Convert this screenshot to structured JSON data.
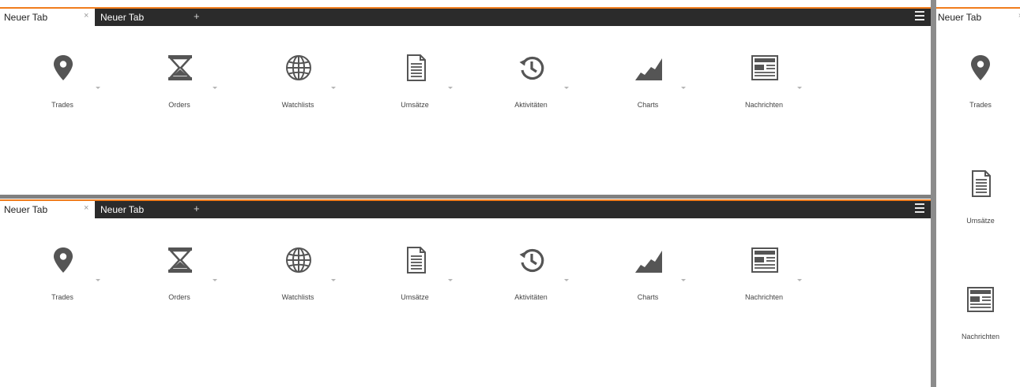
{
  "colors": {
    "accent": "#f07c1c",
    "tabbar_bg": "#2b2b2b",
    "icon": "#555555",
    "splitter": "#8c8c8c"
  },
  "panel_top": {
    "tabs": [
      {
        "label": "Neuer Tab",
        "close": "×"
      },
      {
        "label": "Neuer Tab"
      }
    ],
    "add_label": "+",
    "tiles": [
      {
        "label": "Trades",
        "icon": "map-marker-icon"
      },
      {
        "label": "Orders",
        "icon": "hourglass-icon"
      },
      {
        "label": "Watchlists",
        "icon": "globe-icon"
      },
      {
        "label": "Umsätze",
        "icon": "document-icon"
      },
      {
        "label": "Aktivitäten",
        "icon": "history-icon"
      },
      {
        "label": "Charts",
        "icon": "area-chart-icon"
      },
      {
        "label": "Nachrichten",
        "icon": "newspaper-icon"
      }
    ]
  },
  "panel_bottom": {
    "tabs": [
      {
        "label": "Neuer Tab",
        "close": "×"
      },
      {
        "label": "Neuer Tab"
      }
    ],
    "add_label": "+",
    "tiles": [
      {
        "label": "Trades",
        "icon": "map-marker-icon"
      },
      {
        "label": "Orders",
        "icon": "hourglass-icon"
      },
      {
        "label": "Watchlists",
        "icon": "globe-icon"
      },
      {
        "label": "Umsätze",
        "icon": "document-icon"
      },
      {
        "label": "Aktivitäten",
        "icon": "history-icon"
      },
      {
        "label": "Charts",
        "icon": "area-chart-icon"
      },
      {
        "label": "Nachrichten",
        "icon": "newspaper-icon"
      }
    ]
  },
  "panel_side": {
    "tabs": [
      {
        "label": "Neuer Tab",
        "close": "›"
      }
    ],
    "tiles": [
      {
        "label": "Trades",
        "icon": "map-marker-icon"
      },
      {
        "label": "Umsätze",
        "icon": "document-icon"
      },
      {
        "label": "Nachrichten",
        "icon": "newspaper-icon"
      }
    ]
  }
}
